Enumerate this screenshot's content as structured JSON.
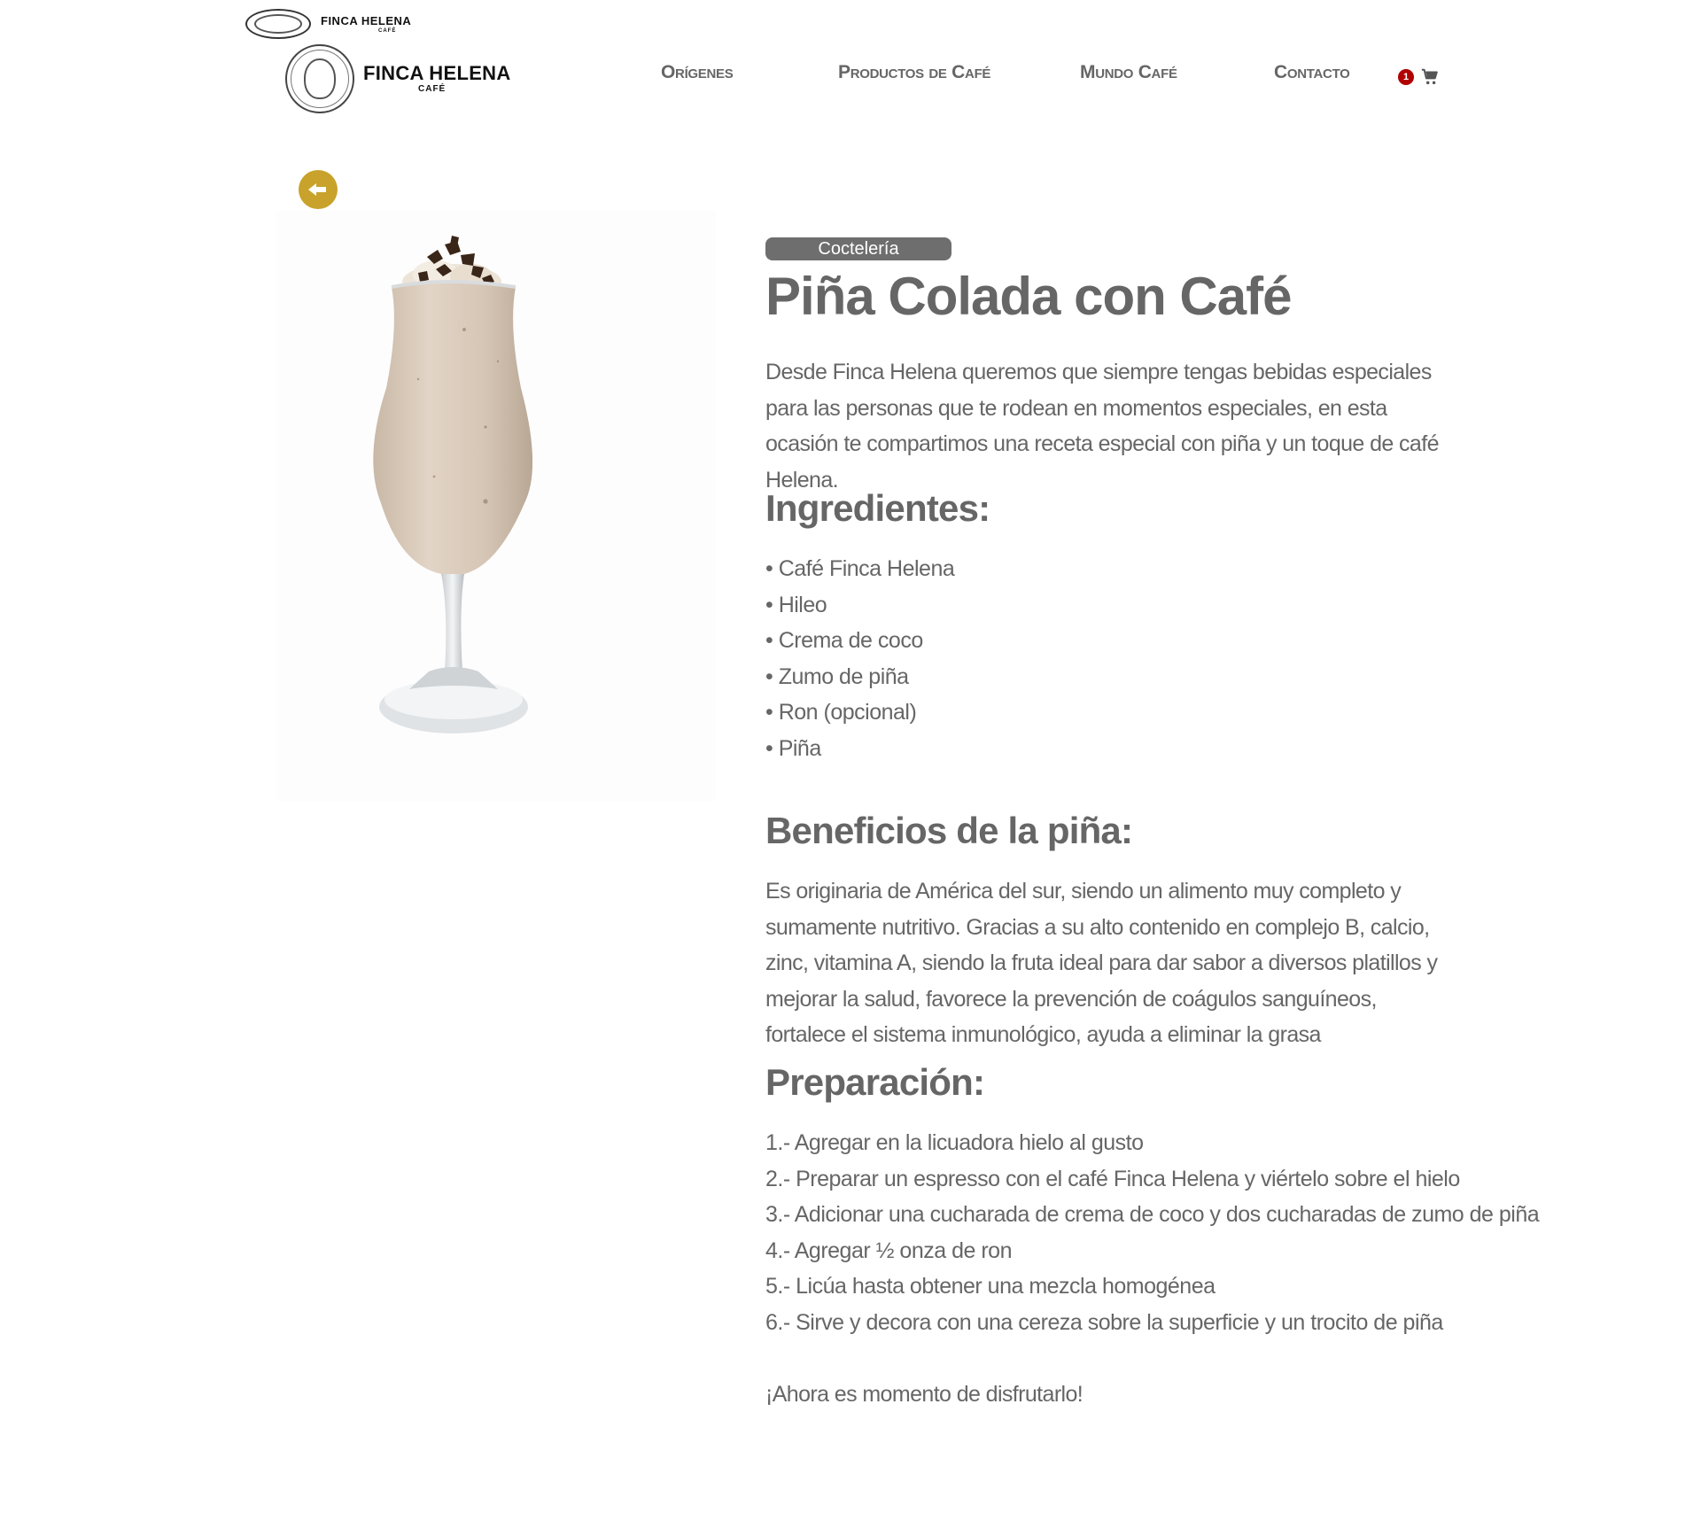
{
  "header": {
    "mini_logo": {
      "brand": "FINCA HELENA",
      "sub": "CAFÉ"
    },
    "logo": {
      "brand": "FINCA HELENA",
      "sub": "CAFÉ"
    },
    "nav": [
      {
        "label": "Orígenes"
      },
      {
        "label": "Productos de Café"
      },
      {
        "label": "Mundo Café"
      },
      {
        "label": "Contacto"
      }
    ],
    "cart": {
      "count": "1",
      "icon": "shopping-cart-icon"
    }
  },
  "back_button": {
    "icon": "arrow-left-icon"
  },
  "product": {
    "image_alt": "Piña Colada con Café",
    "category": "Coctelería",
    "title": "Piña Colada con Café",
    "intro": "Desde Finca Helena queremos que siempre tengas bebidas especiales para las personas que te rodean en momentos  especiales,  en esta ocasión te compartimos una receta especial con piña y un toque de café Helena.",
    "ingredients_heading": "Ingredientes:",
    "ingredients": [
      "• Café Finca Helena",
      "• Hileo",
      "• Crema de coco",
      "• Zumo de piña",
      "• Ron (opcional)",
      "• Piña"
    ],
    "benefits_heading": "Beneficios de la piña:",
    "benefits": "Es originaria de América del sur, siendo un alimento muy completo y sumamente nutritivo. Gracias a su alto contenido en complejo B, calcio, zinc, vitamina A, siendo la fruta ideal para dar sabor a diversos platillos y mejorar la salud, favorece la prevención de coágulos sanguíneos, fortalece el sistema inmunológico, ayuda a eliminar la grasa",
    "preparation_heading": "Preparación:",
    "steps": [
      "1.- Agregar en la licuadora hielo al gusto",
      "2.- Preparar un espresso con el café Finca Helena y viértelo sobre el hielo",
      "3.- Adicionar una cucharada de crema de coco y dos cucharadas de zumo de piña",
      "4.- Agregar ½ onza de ron",
      "5.- Licúa hasta obtener una mezcla homogénea",
      "6.- Sirve y decora con una cereza sobre la superficie y un trocito de piña"
    ],
    "closing": "¡Ahora es momento de disfrutarlo!"
  },
  "colors": {
    "accent": "#c9a22b",
    "text": "#666666",
    "badge_bg": "#6e6e6e",
    "cart_badge": "#b00000"
  }
}
